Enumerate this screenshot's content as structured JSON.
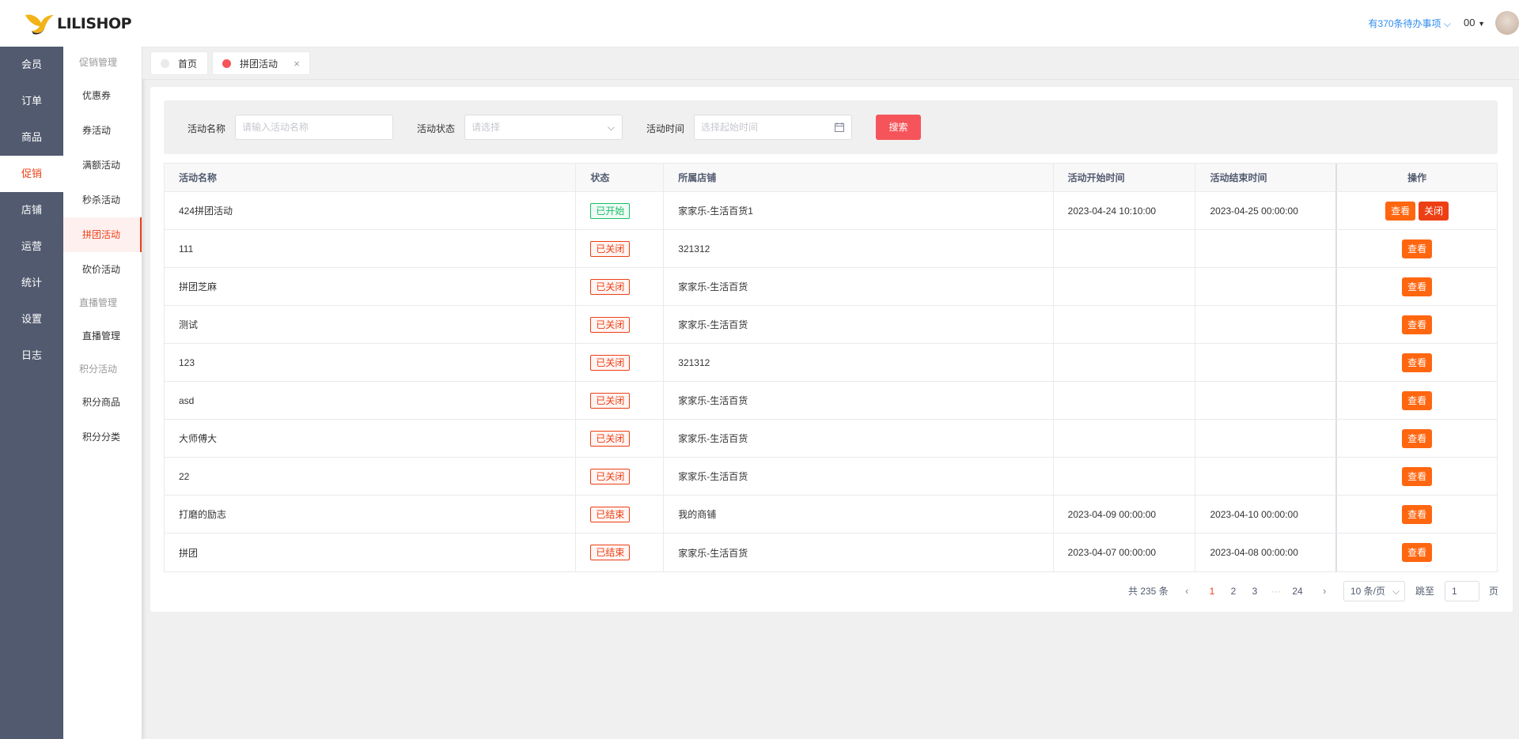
{
  "logo": {
    "text": "LILISHOP"
  },
  "header": {
    "todo": "有370条待办事项",
    "user": "00"
  },
  "nav": {
    "items": [
      {
        "label": "会员"
      },
      {
        "label": "订单"
      },
      {
        "label": "商品"
      },
      {
        "label": "促销"
      },
      {
        "label": "店铺"
      },
      {
        "label": "运营"
      },
      {
        "label": "统计"
      },
      {
        "label": "设置"
      },
      {
        "label": "日志"
      }
    ]
  },
  "submenu": {
    "group1": "促销管理",
    "items1": [
      "优惠券",
      "券活动",
      "满额活动",
      "秒杀活动",
      "拼团活动",
      "砍价活动"
    ],
    "group2": "直播管理",
    "items2": [
      "直播管理"
    ],
    "group3": "积分活动",
    "items3": [
      "积分商品",
      "积分分类"
    ]
  },
  "tabs": [
    {
      "label": "首页"
    },
    {
      "label": "拼团活动"
    }
  ],
  "filter": {
    "name_label": "活动名称",
    "name_placeholder": "请输入活动名称",
    "status_label": "活动状态",
    "status_placeholder": "请选择",
    "time_label": "活动时间",
    "time_placeholder": "选择起始时间",
    "search_label": "搜索"
  },
  "table": {
    "headers": [
      "活动名称",
      "状态",
      "所属店铺",
      "活动开始时间",
      "活动结束时间",
      "操作"
    ],
    "rows": [
      {
        "name": "424拼团活动",
        "status": "已开始",
        "store": "家家乐-生活百货1",
        "start": "2023-04-24 10:10:00",
        "end": "2023-04-25 00:00:00"
      },
      {
        "name": "111",
        "status": "已关闭",
        "store": "321312",
        "start": "",
        "end": ""
      },
      {
        "name": "拼团芝麻",
        "status": "已关闭",
        "store": "家家乐-生活百货",
        "start": "",
        "end": ""
      },
      {
        "name": "测试",
        "status": "已关闭",
        "store": "家家乐-生活百货",
        "start": "",
        "end": ""
      },
      {
        "name": "123",
        "status": "已关闭",
        "store": "321312",
        "start": "",
        "end": ""
      },
      {
        "name": "asd",
        "status": "已关闭",
        "store": "家家乐-生活百货",
        "start": "",
        "end": ""
      },
      {
        "name": "大师傅大",
        "status": "已关闭",
        "store": "家家乐-生活百货",
        "start": "",
        "end": ""
      },
      {
        "name": "22",
        "status": "已关闭",
        "store": "家家乐-生活百货",
        "start": "",
        "end": ""
      },
      {
        "name": "打磨的励志",
        "status": "已结束",
        "store": "我的商铺",
        "start": "2023-04-09 00:00:00",
        "end": "2023-04-10 00:00:00"
      },
      {
        "name": "拼团",
        "status": "已结束",
        "store": "家家乐-生活百货",
        "start": "2023-04-07 00:00:00",
        "end": "2023-04-08 00:00:00"
      }
    ],
    "view_label": "查看",
    "close_label": "关闭"
  },
  "pagination": {
    "total": "共 235 条",
    "pages": [
      "1",
      "2",
      "3",
      "···",
      "24"
    ],
    "page_size": "10 条/页",
    "jump_label": "跳至",
    "jump_value": "1",
    "page_suffix": "页"
  },
  "colors": {
    "accent": "#ed3f14",
    "nav_bg": "#515a6e",
    "view_btn": "#ff6610",
    "search_btn": "#f5555a"
  }
}
